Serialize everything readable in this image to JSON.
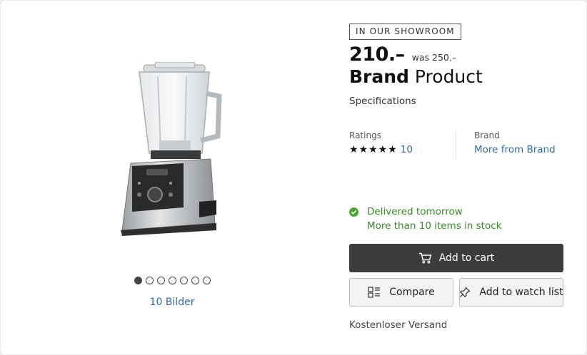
{
  "gallery": {
    "image_alt": "blender",
    "dots": [
      true,
      false,
      false,
      false,
      false,
      false,
      false
    ],
    "image_count": "10 Bilder"
  },
  "product": {
    "badge": "IN OUR SHOWROOM",
    "price": "210.–",
    "was_price": "was 250.–",
    "brand": "Brand",
    "name": "Product",
    "specs_link": "Specifications"
  },
  "ratings": {
    "label": "Ratings",
    "stars": "★★★★★",
    "count": "10"
  },
  "brand_info": {
    "label": "Brand",
    "link": "More from Brand"
  },
  "delivery": {
    "status": "Delivered tomorrow",
    "stock": "More than 10 items in stock"
  },
  "actions": {
    "add_to_cart": "Add to cart",
    "compare": "Compare",
    "watch_list": "Add to watch list"
  },
  "shipping": "Kostenloser Versand",
  "colors": {
    "link": "#2c6cb0",
    "success": "#3a8a2a",
    "cart_button": "#3c3c3c"
  }
}
